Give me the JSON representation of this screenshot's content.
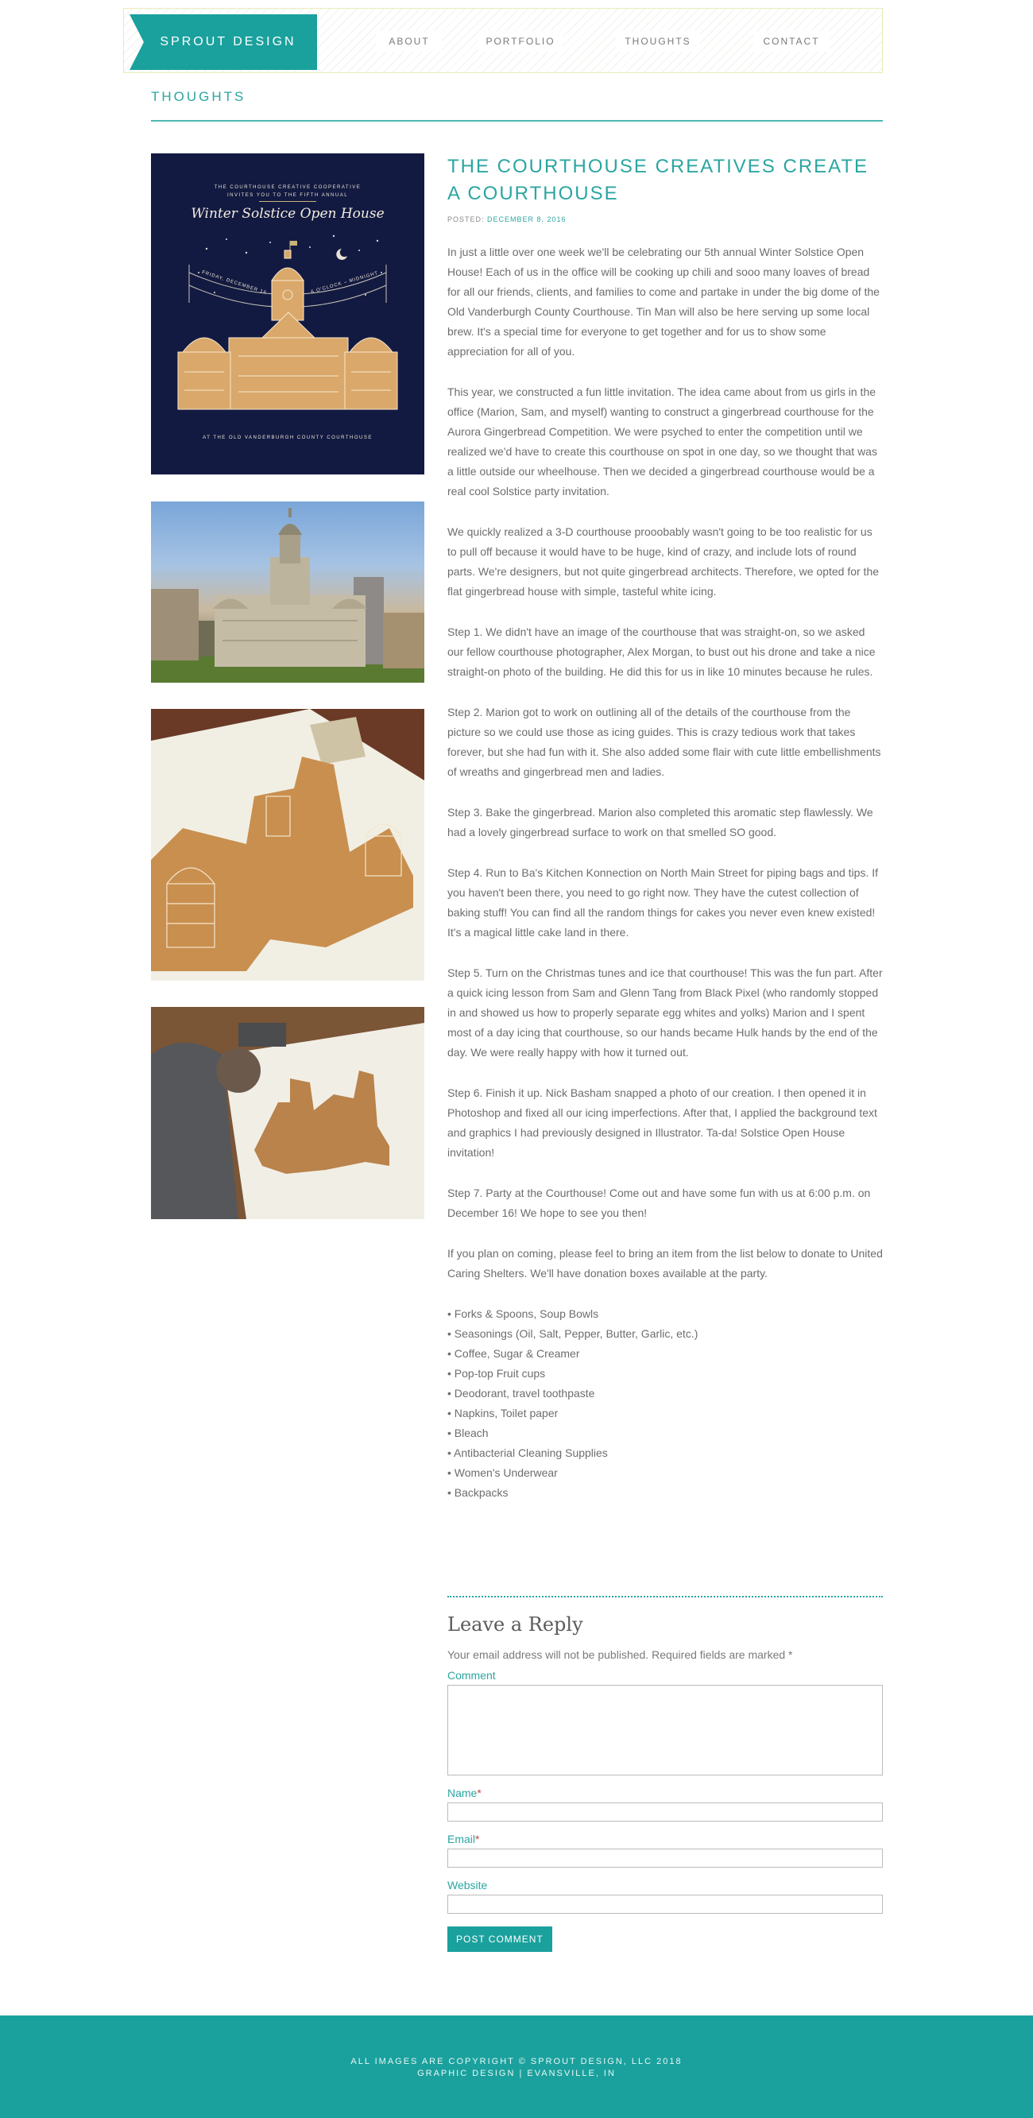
{
  "site": {
    "logo": "SPROUT DESIGN",
    "nav": [
      {
        "label": "ABOUT"
      },
      {
        "label": "PORTFOLIO"
      },
      {
        "label": "THOUGHTS"
      },
      {
        "label": "CONTACT"
      }
    ]
  },
  "section": {
    "title": "THOUGHTS"
  },
  "poster": {
    "line1": "THE COURTHOUSE CREATIVE COOPERATIVE",
    "line2": "INVITES YOU TO THE FIFTH ANNUAL",
    "title": "Winter Solstice Open House",
    "banner_left": "FRIDAY, DECEMBER 16",
    "banner_right": "6 O'CLOCK – MIDNIGHT",
    "bottom": "AT THE OLD VANDERBURGH COUNTY COURTHOUSE"
  },
  "post": {
    "title": "THE COURTHOUSE CREATIVES CREATE A COURTHOUSE",
    "posted_label": "POSTED:",
    "date": "DECEMBER 8, 2016",
    "paragraphs": [
      "In just a little over one week we'll be celebrating our 5th annual Winter Solstice Open House! Each of us in the office will be cooking up chili and sooo many loaves of bread for all our friends, clients, and families to come and partake in under the big dome of the Old Vanderburgh County Courthouse. Tin Man will also be here serving up some local brew. It's a special time for everyone to get together and for us to show some appreciation for all of you.",
      "This year, we constructed a fun little invitation. The idea came about from us girls in the office (Marion, Sam, and myself) wanting to construct a gingerbread courthouse for the Aurora Gingerbread Competition. We were psyched to enter the competition until we realized we'd have to create this courthouse on spot in one day, so we thought that was a little outside our wheelhouse. Then we decided a gingerbread courthouse would be a real cool Solstice party invitation.",
      "We quickly realized a 3-D courthouse prooobably wasn't going to be too realistic for us to pull off because it would have to be huge, kind of crazy, and include lots of round parts. We're designers, but not quite gingerbread architects. Therefore, we opted for the flat gingerbread house with simple, tasteful white icing.",
      "Step 1. We didn't have an image of the courthouse that was straight-on, so we asked our fellow courthouse photographer, Alex Morgan, to bust out his drone and take a nice straight-on photo of the building. He did this for us in like 10 minutes because he rules.",
      "Step 2. Marion got to work on outlining all of the details of the courthouse from the picture so we could use those as icing guides. This is crazy tedious work that takes forever, but she had fun with it. She also added some flair with cute little embellishments of wreaths and gingerbread men and ladies.",
      "Step 3. Bake the gingerbread. Marion also completed this aromatic step flawlessly. We had a lovely gingerbread surface to work on that smelled SO good.",
      "Step 4. Run to Ba's Kitchen Konnection on North Main Street for piping bags and tips. If you haven't been there, you need to go right now. They have the cutest collection of baking stuff! You can find all the random things for cakes you never even knew existed! It's a magical little cake land in there.",
      "Step 5. Turn on the Christmas tunes and ice that courthouse! This was the fun part. After a quick icing lesson from Sam and Glenn Tang from Black Pixel (who randomly stopped in and showed us how to properly separate egg whites and yolks) Marion and I spent most of a day icing that courthouse, so our hands became Hulk hands by the end of the day. We were really happy with how it turned out.",
      "Step 6. Finish it up. Nick Basham snapped a photo of our creation. I then opened it in Photoshop and fixed all our icing imperfections. After that, I applied the background text and graphics I had previously designed in Illustrator. Ta-da! Solstice Open House invitation!",
      "Step 7. Party at the Courthouse! Come out and have some fun with us at 6:00 p.m. on December 16! We hope to see you then!",
      "If you plan on coming, please feel to bring an item from the list below to donate to United Caring Shelters. We'll have donation boxes available at the party."
    ],
    "donation_items": [
      "• Forks & Spoons, Soup Bowls",
      "• Seasonings (Oil, Salt, Pepper, Butter, Garlic, etc.)",
      "• Coffee, Sugar & Creamer",
      "• Pop-top Fruit cups",
      "• Deodorant, travel toothpaste",
      "• Napkins, Toilet paper",
      "• Bleach",
      "• Antibacterial Cleaning Supplies",
      "• Women's Underwear",
      "• Backpacks"
    ]
  },
  "reply": {
    "title": "Leave a Reply",
    "note": "Your email address will not be published. Required fields are marked *",
    "comment_label": "Comment",
    "name_label": "Name",
    "email_label": "Email",
    "website_label": "Website",
    "required_mark": "*",
    "submit_label": "POST COMMENT"
  },
  "footer": {
    "line1": "ALL IMAGES ARE COPYRIGHT © SPROUT DESIGN, LLC 2018",
    "line2": "GRAPHIC DESIGN | EVANSVILLE, IN"
  },
  "colors": {
    "accent": "#1aa19d",
    "text": "#6d6d6d",
    "poster_bg": "#131a41"
  }
}
